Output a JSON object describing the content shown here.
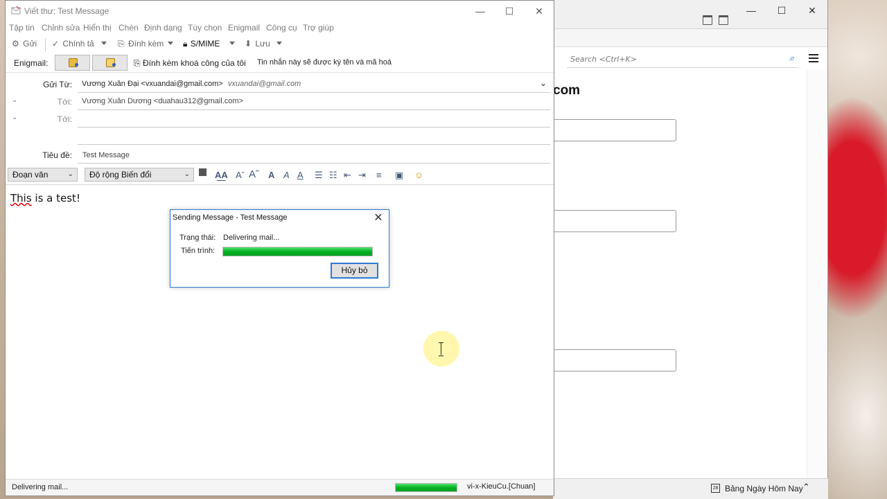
{
  "window": {
    "title": "Viết thư: Test Message"
  },
  "menu": {
    "items": [
      "Tập tin",
      "Chỉnh sửa",
      "Hiển thị",
      "Chèn",
      "Định dạng",
      "Tùy chọn",
      "Enigmail",
      "Công cụ",
      "Trợ giúp"
    ]
  },
  "toolbar": {
    "send": "Gửi",
    "spell": "Chính tả",
    "attach": "Đính kèm",
    "smime": "S/MIME",
    "save": "Lưu"
  },
  "enigmail": {
    "label": "Enigmail:",
    "attach_key": "Đính kèm khoá công của tôi",
    "note": "Tin nhắn này sẽ được ký tên và mã hoá"
  },
  "headers": {
    "from_label": "Gửi Từ:",
    "from_value": "Vương Xuân Đại <vxuandai@gmail.com>",
    "from_identity": "vxuandai@gmail.com",
    "to_label_1": "Tới:",
    "to_value_1": "Vương Xuân Dương <duahau312@gmail.com>",
    "to_label_2": "Tới:",
    "to_value_2": "",
    "subject_label": "Tiêu đề:",
    "subject_value": "Test Message"
  },
  "format": {
    "paragraph": "Đoạn văn",
    "font": "Độ rộng Biến đổi"
  },
  "body": {
    "text_word": "This",
    "text_rest": " is a test!"
  },
  "dialog": {
    "title": "Sending Message - Test Message",
    "status_label": "Trạng thái:",
    "status_value": "Delivering mail...",
    "progress_label": "Tiến trình:",
    "progress": 1.0,
    "cancel": "Hủy bỏ"
  },
  "statusbar": {
    "text": "Delivering mail...",
    "progress": 1.0,
    "language": "vi-x-KieuCu.[Chuan]"
  },
  "background_window": {
    "search_placeholder": "Search <Ctrl+K>",
    "heading_fragment": "com",
    "today_label": "Bảng Ngày Hôm Nay",
    "today_day": "28"
  }
}
